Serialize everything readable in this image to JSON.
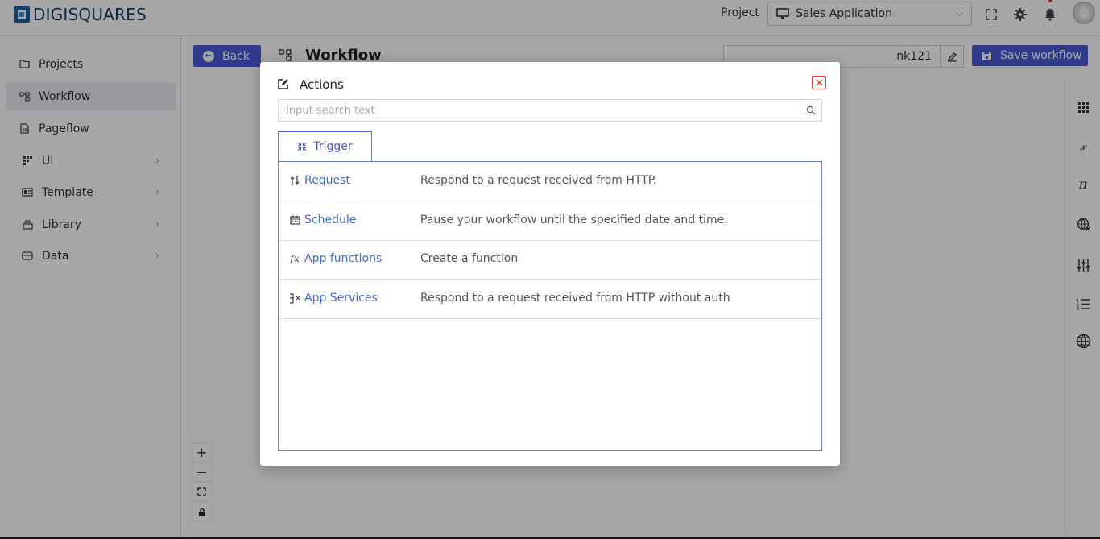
{
  "header": {
    "logo_text": "DIGISQUARES",
    "project_label": "Project",
    "project_value": "Sales Application"
  },
  "sidebar": {
    "items": [
      {
        "label": "Projects",
        "icon": "folder-icon"
      },
      {
        "label": "Workflow",
        "icon": "workflow-icon",
        "active": true
      },
      {
        "label": "Pageflow",
        "icon": "pageflow-icon"
      },
      {
        "label": "UI",
        "icon": "ui-icon",
        "expandable": true
      },
      {
        "label": "Template",
        "icon": "template-icon",
        "expandable": true
      },
      {
        "label": "Library",
        "icon": "library-icon",
        "expandable": true
      },
      {
        "label": "Data",
        "icon": "data-icon",
        "expandable": true
      }
    ]
  },
  "toolbar": {
    "back_label": "Back",
    "title": "Workflow",
    "name_value": "nk121",
    "save_label": "Save workflow"
  },
  "zoom": {
    "plus": "+",
    "minus": "—"
  },
  "modal": {
    "title": "Actions",
    "search_placeholder": "Input search text",
    "tab_label": "Trigger",
    "rows": [
      {
        "name": "Request",
        "description": "Respond to a request received from HTTP.",
        "icon": "request-icon"
      },
      {
        "name": "Schedule",
        "description": "Pause your workflow until the specified date and time.",
        "icon": "schedule-icon"
      },
      {
        "name": "App functions",
        "description": "Create a function",
        "icon": "function-icon"
      },
      {
        "name": "App Services",
        "description": "Respond to a request received from HTTP without auth",
        "icon": "services-icon"
      }
    ]
  },
  "colors": {
    "accent": "#4a5bd6",
    "link": "#3d6bd1",
    "close": "#e03b3b"
  }
}
